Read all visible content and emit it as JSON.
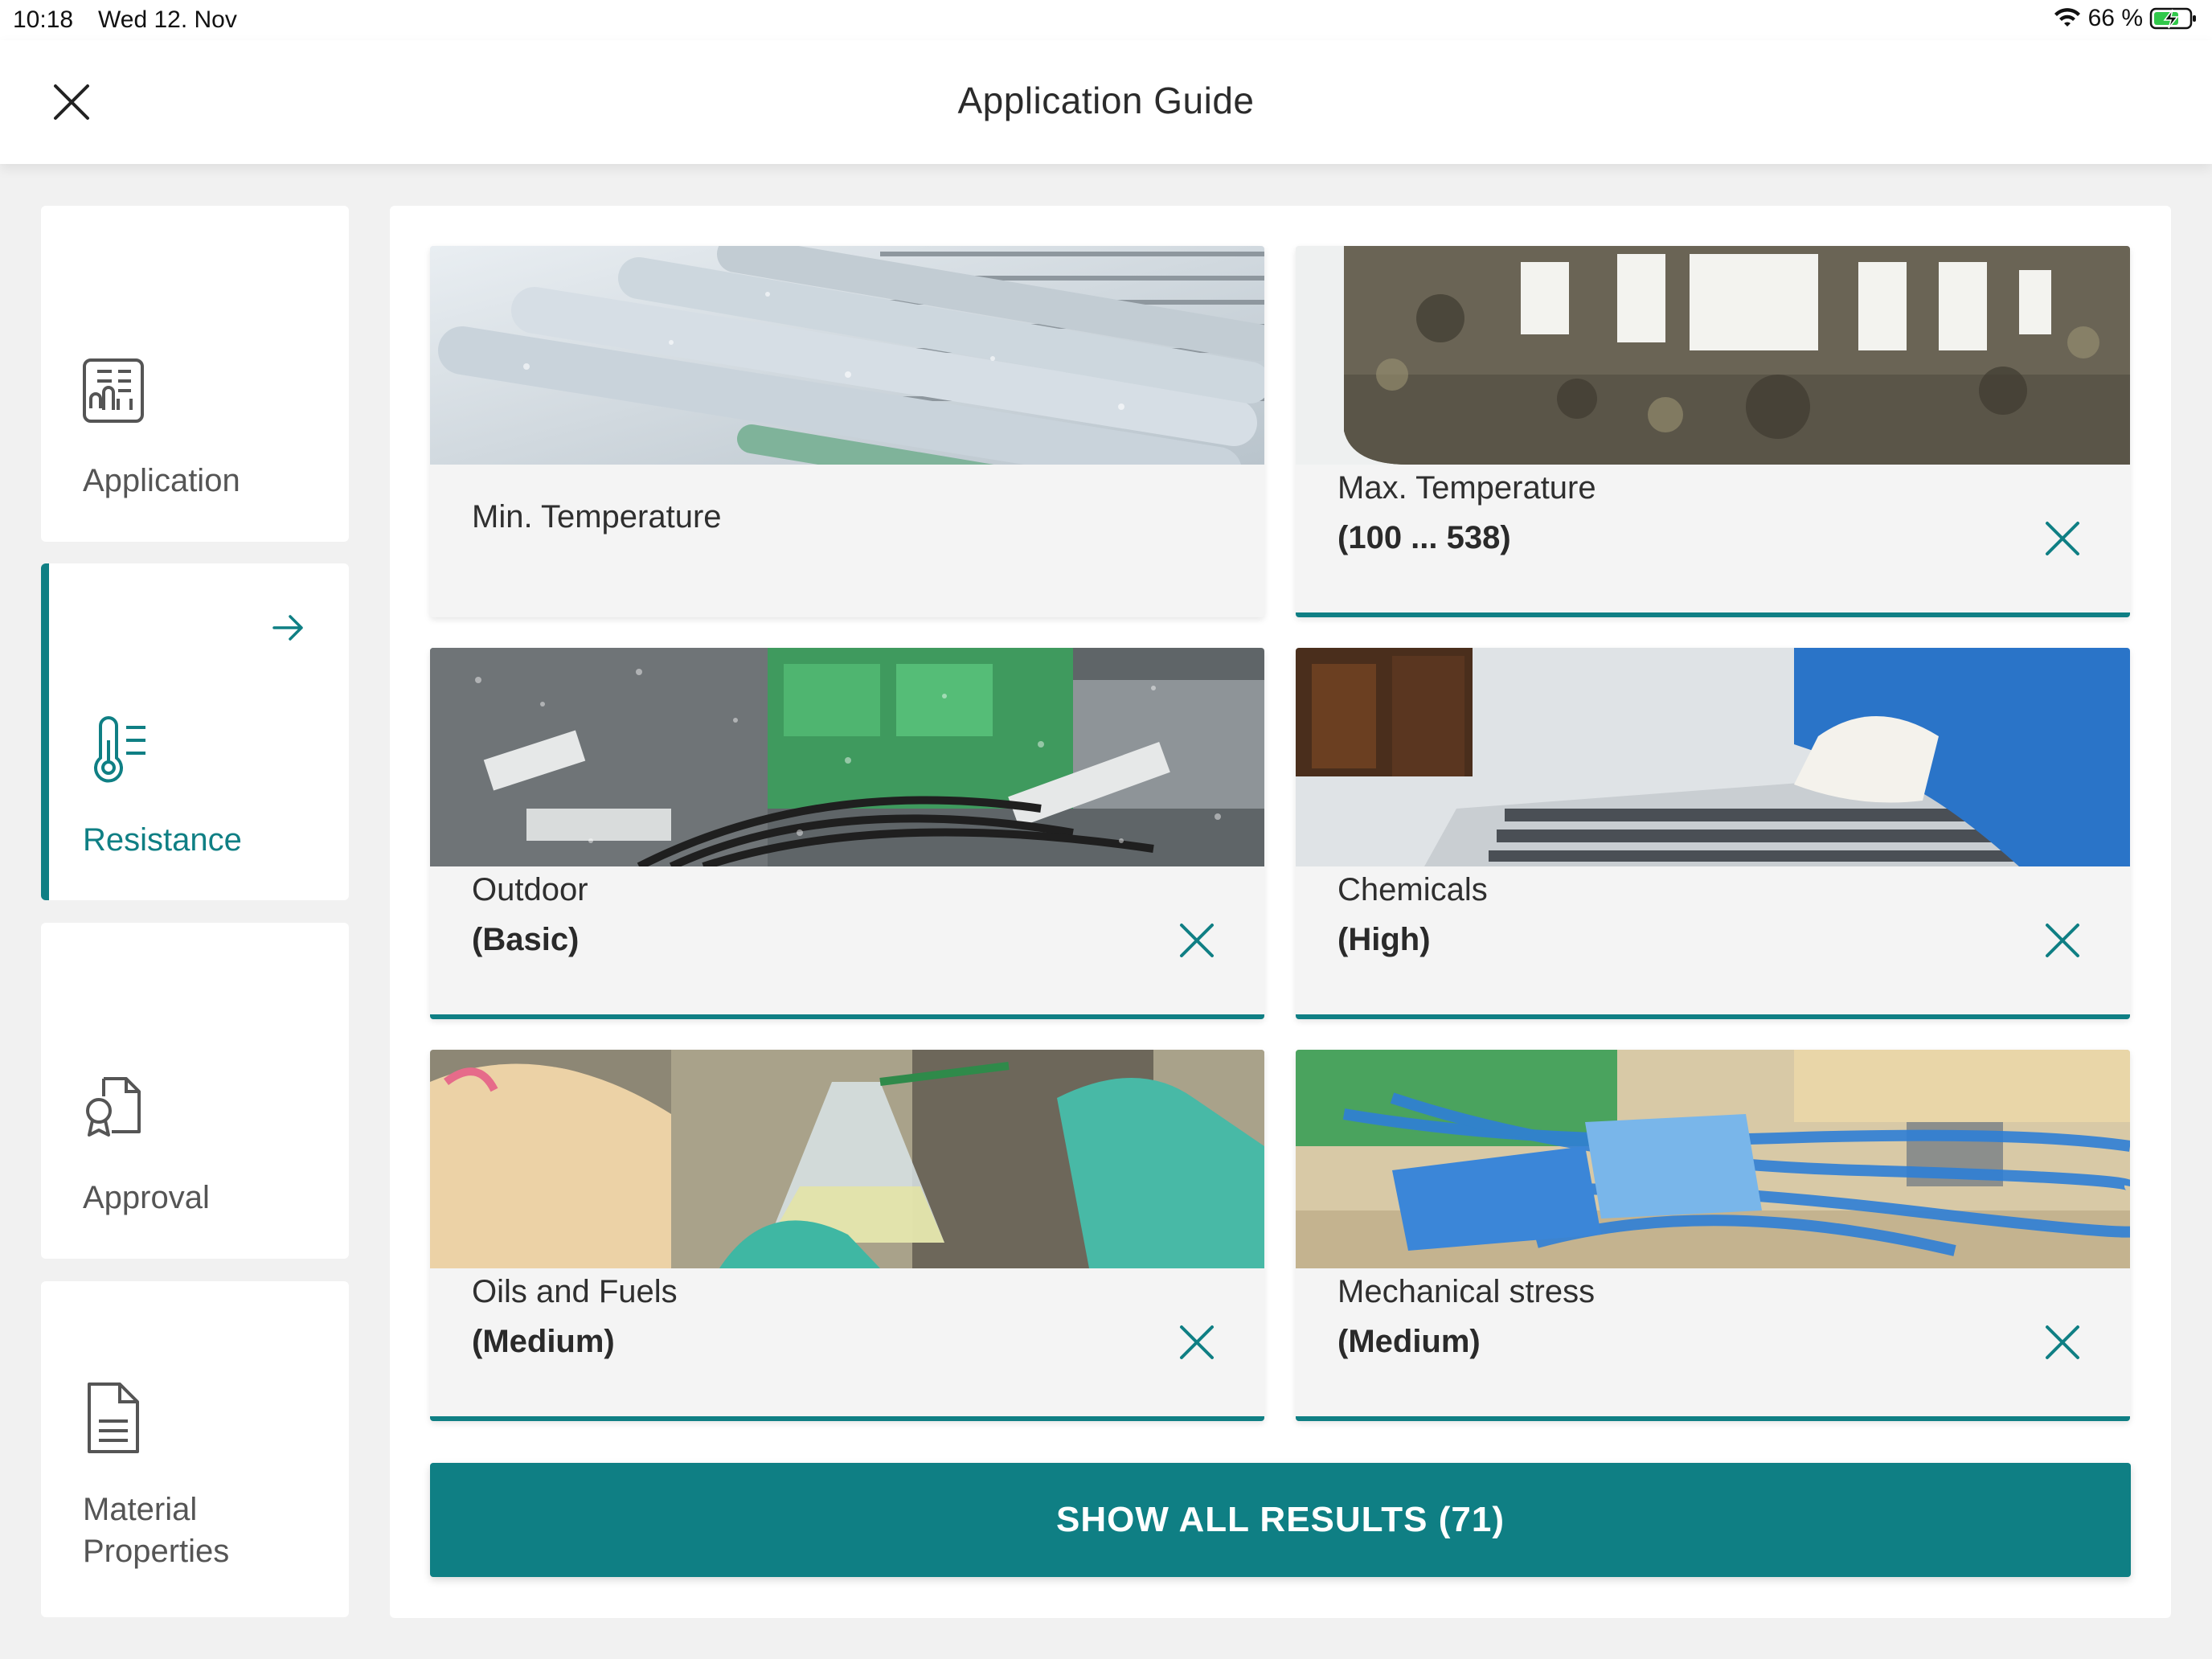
{
  "status_bar": {
    "time": "10:18",
    "date": "Wed 12. Nov",
    "battery_percent": "66 %",
    "wifi_icon": "wifi-icon",
    "battery_icon": "battery-charging-icon"
  },
  "header": {
    "title": "Application Guide",
    "close_icon": "close-icon"
  },
  "sidebar": {
    "items": [
      {
        "label": "Application",
        "icon": "application-icon",
        "active": false
      },
      {
        "label": "Resistance",
        "icon": "thermometer-list-icon",
        "active": true
      },
      {
        "label": "Approval",
        "icon": "approval-icon",
        "active": false
      },
      {
        "label": "Material Properties",
        "label_line1": "Material",
        "label_line2": "Properties",
        "icon": "document-icon",
        "active": false
      }
    ],
    "active_arrow_icon": "arrow-right-icon"
  },
  "tiles": [
    {
      "title": "Min. Temperature",
      "value": "",
      "selected": false,
      "image": "frozen-cables-photo"
    },
    {
      "title": "Max. Temperature",
      "value": "(100 ... 538)",
      "selected": true,
      "image": "burnt-terminal-block-photo"
    },
    {
      "title": "Outdoor",
      "value": "(Basic)",
      "selected": true,
      "image": "wet-terminal-blocks-photo"
    },
    {
      "title": "Chemicals",
      "value": "(High)",
      "selected": true,
      "image": "gloved-hand-wiping-photo"
    },
    {
      "title": "Oils and Fuels",
      "value": "(Medium)",
      "selected": true,
      "image": "lab-flask-photo"
    },
    {
      "title": "Mechanical stress",
      "value": "(Medium)",
      "selected": true,
      "image": "blue-cables-photo"
    }
  ],
  "show_all_button": {
    "label": "SHOW ALL RESULTS (71)"
  },
  "colors": {
    "accent": "#0f7f84",
    "background": "#f1f1f1",
    "card": "#ffffff",
    "tile": "#f4f4f4"
  }
}
